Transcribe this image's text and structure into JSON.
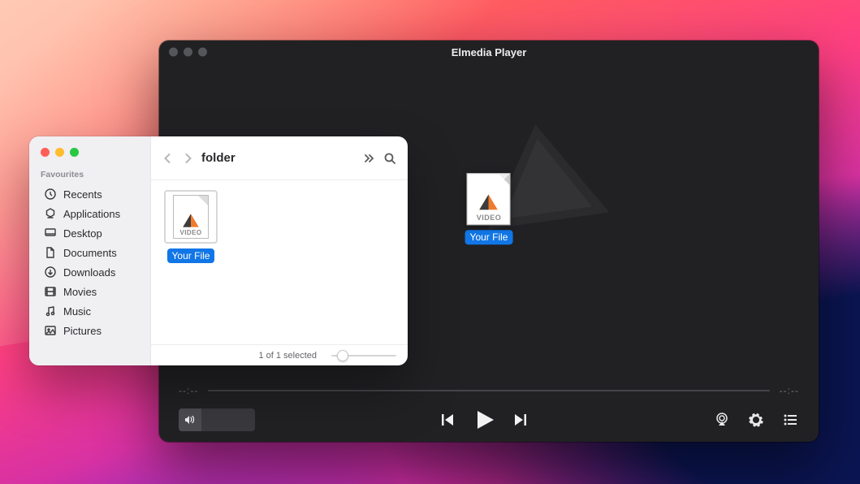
{
  "player": {
    "title": "Elmedia Player",
    "drop_file_label": "Your File",
    "drop_file_tag": "VIDEO",
    "time_elapsed": "--:--",
    "time_remaining": "--:--"
  },
  "finder": {
    "title": "folder",
    "sidebar_header": "Favourites",
    "items": [
      {
        "icon": "clock",
        "label": "Recents"
      },
      {
        "icon": "apps",
        "label": "Applications"
      },
      {
        "icon": "desktop",
        "label": "Desktop"
      },
      {
        "icon": "doc",
        "label": "Documents"
      },
      {
        "icon": "download",
        "label": "Downloads"
      },
      {
        "icon": "movie",
        "label": "Movies"
      },
      {
        "icon": "music",
        "label": "Music"
      },
      {
        "icon": "picture",
        "label": "Pictures"
      }
    ],
    "file_name": "Your File",
    "file_tag": "VIDEO",
    "status_text": "1 of 1 selected"
  }
}
